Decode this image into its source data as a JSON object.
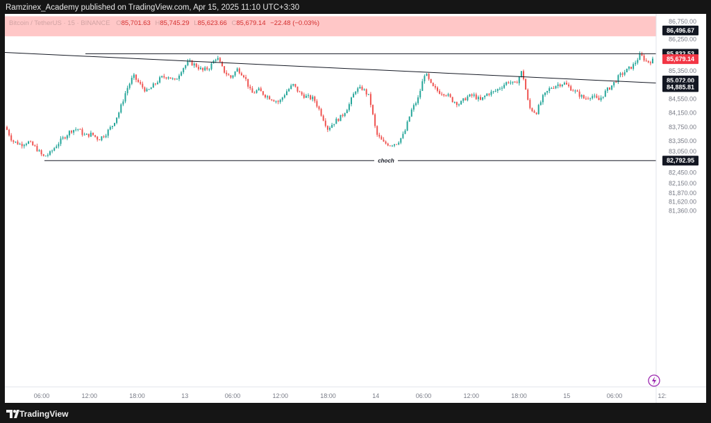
{
  "header": {
    "publisher": "Ramzinex_Academy published on TradingView.com, Apr 15, 2025 11:10 UTC+3:30"
  },
  "footer": {
    "brand": "TradingView"
  },
  "symbol_info": {
    "name": "Bitcoin / TetherUS · 15 · BINANCE",
    "open_label": "O",
    "open": "85,701.63",
    "high_label": "H",
    "high": "85,745.29",
    "low_label": "L",
    "low": "85,623.66",
    "close_label": "C",
    "close": "85,679.14",
    "change": "−22.48 (−0.03%)"
  },
  "colors": {
    "up": "#26a69a",
    "down": "#ef5350",
    "zone": "#ffc7c7",
    "last_price": "#f23645"
  },
  "chart_data": {
    "type": "candlestick",
    "title": "",
    "xlabel": "",
    "ylabel": "",
    "ylim": [
      81250,
      86900
    ],
    "x_ticks": [
      "06:00",
      "12:00",
      "18:00",
      "13",
      "06:00",
      "12:00",
      "18:00",
      "14",
      "06:00",
      "12:00",
      "18:00",
      "15",
      "06:00",
      "12:"
    ],
    "y_ticks": [
      "86,750.00",
      "86,250.00",
      "85,350.00",
      "84,550.00",
      "84,150.00",
      "83,750.00",
      "83,350.00",
      "83,050.00",
      "82,450.00",
      "82,150.00",
      "81,870.00",
      "81,620.00",
      "81,360.00"
    ],
    "price_labels": [
      {
        "text": "86,496.67",
        "value": 86496.67,
        "style": "dark"
      },
      {
        "text": "85,832.53",
        "value": 85832.53,
        "style": "dark"
      },
      {
        "text": "85,679.14",
        "value": 85679.14,
        "style": "red"
      },
      {
        "text": "85,072.00",
        "value": 85072.0,
        "style": "dark"
      },
      {
        "text": "84,885.81",
        "value": 84885.81,
        "style": "dark"
      },
      {
        "text": "82,792.95",
        "value": 82792.95,
        "style": "dark"
      }
    ],
    "zone": {
      "from": 86330,
      "to": 86900
    },
    "lines": [
      {
        "name": "resistance",
        "value": 85832.53
      },
      {
        "name": "choch",
        "value": 82792.95,
        "label": "choch"
      }
    ],
    "trendline": {
      "start_value": 85870,
      "end_value": 85000
    },
    "close_path": [
      [
        0,
        83750
      ],
      [
        10,
        83350
      ],
      [
        22,
        83250
      ],
      [
        32,
        83330
      ],
      [
        44,
        83150
      ],
      [
        54,
        82900
      ],
      [
        64,
        83000
      ],
      [
        74,
        83250
      ],
      [
        84,
        83450
      ],
      [
        94,
        83650
      ],
      [
        104,
        83700
      ],
      [
        114,
        83500
      ],
      [
        124,
        83550
      ],
      [
        134,
        83400
      ],
      [
        144,
        83550
      ],
      [
        154,
        83800
      ],
      [
        164,
        84200
      ],
      [
        174,
        84800
      ],
      [
        184,
        85200
      ],
      [
        194,
        84950
      ],
      [
        204,
        84750
      ],
      [
        214,
        84950
      ],
      [
        224,
        85150
      ],
      [
        234,
        85200
      ],
      [
        244,
        85050
      ],
      [
        254,
        85400
      ],
      [
        264,
        85600
      ],
      [
        274,
        85500
      ],
      [
        284,
        85350
      ],
      [
        294,
        85450
      ],
      [
        304,
        85750
      ],
      [
        314,
        85350
      ],
      [
        324,
        85150
      ],
      [
        334,
        85400
      ],
      [
        344,
        85200
      ],
      [
        354,
        84700
      ],
      [
        364,
        84800
      ],
      [
        374,
        84650
      ],
      [
        384,
        84550
      ],
      [
        394,
        84450
      ],
      [
        404,
        84750
      ],
      [
        414,
        84950
      ],
      [
        424,
        84700
      ],
      [
        434,
        84600
      ],
      [
        444,
        84550
      ],
      [
        454,
        84150
      ],
      [
        464,
        83700
      ],
      [
        474,
        83900
      ],
      [
        484,
        84050
      ],
      [
        494,
        84350
      ],
      [
        504,
        84800
      ],
      [
        514,
        84850
      ],
      [
        524,
        84600
      ],
      [
        534,
        83550
      ],
      [
        544,
        83300
      ],
      [
        554,
        83250
      ],
      [
        564,
        83300
      ],
      [
        574,
        83550
      ],
      [
        584,
        84200
      ],
      [
        594,
        84550
      ],
      [
        604,
        85300
      ],
      [
        614,
        84900
      ],
      [
        624,
        84750
      ],
      [
        634,
        84700
      ],
      [
        644,
        84500
      ],
      [
        654,
        84400
      ],
      [
        664,
        84600
      ],
      [
        674,
        84650
      ],
      [
        684,
        84500
      ],
      [
        694,
        84700
      ],
      [
        704,
        84750
      ],
      [
        714,
        84900
      ],
      [
        724,
        85050
      ],
      [
        734,
        84950
      ],
      [
        744,
        85350
      ],
      [
        754,
        84300
      ],
      [
        764,
        84150
      ],
      [
        774,
        84600
      ],
      [
        784,
        84850
      ],
      [
        794,
        84950
      ],
      [
        804,
        85000
      ],
      [
        814,
        84850
      ],
      [
        824,
        84700
      ],
      [
        834,
        84550
      ],
      [
        844,
        84650
      ],
      [
        854,
        84500
      ],
      [
        864,
        84750
      ],
      [
        874,
        84950
      ],
      [
        884,
        85200
      ],
      [
        894,
        85350
      ],
      [
        904,
        85500
      ],
      [
        914,
        85800
      ],
      [
        924,
        85600
      ],
      [
        934,
        85650
      ]
    ]
  }
}
